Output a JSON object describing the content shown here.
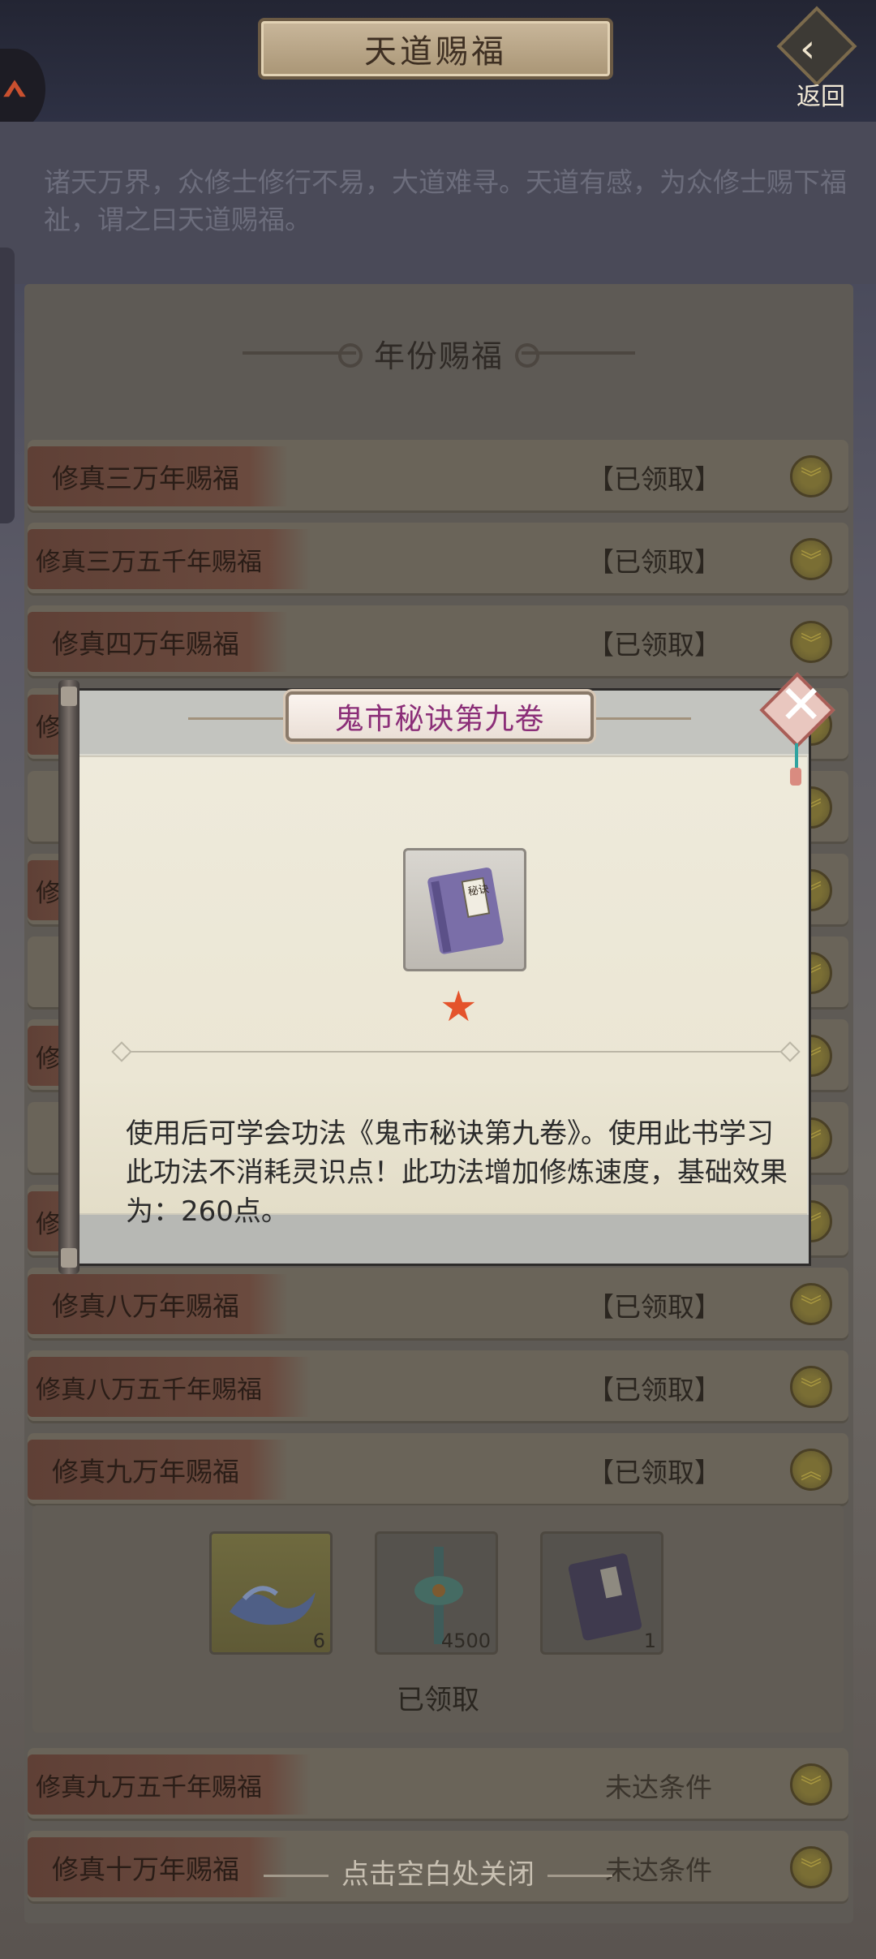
{
  "header": {
    "title": "天道赐福",
    "back_label": "返回"
  },
  "intro": {
    "text": "诸天万界，众修士修行不易，大道难寻。天道有感，为众修士赐下福祉，谓之曰天道赐福。"
  },
  "section": {
    "title": "年份赐福"
  },
  "rows": [
    {
      "name": "修真三万年赐福",
      "status": "【已领取】"
    },
    {
      "name": "修真三万五千年赐福",
      "status": "【已领取】"
    },
    {
      "name": "修真四万年赐福",
      "status": "【已领取】"
    },
    {
      "name": "修",
      "status": ""
    },
    {
      "name": "",
      "status": ""
    },
    {
      "name": "修",
      "status": ""
    },
    {
      "name": "",
      "status": ""
    },
    {
      "name": "修",
      "status": ""
    },
    {
      "name": "",
      "status": ""
    },
    {
      "name": "修",
      "status": ""
    },
    {
      "name": "修真八万年赐福",
      "status": "【已领取】"
    },
    {
      "name": "修真八万五千年赐福",
      "status": "【已领取】"
    },
    {
      "name": "修真九万年赐福",
      "status": "【已领取】"
    },
    {
      "name": "修真九万五千年赐福",
      "status": "未达条件"
    },
    {
      "name": "修真十万年赐福",
      "status": "未达条件"
    }
  ],
  "expanded": {
    "rewards": [
      {
        "icon": "water-wave-icon",
        "count": "6"
      },
      {
        "icon": "jade-pendant-icon",
        "count": "4500"
      },
      {
        "icon": "manual-book-icon",
        "count": "1"
      }
    ],
    "status": "已领取"
  },
  "modal": {
    "title": "鬼市秘诀第九卷",
    "item_icon": "purple-book-icon",
    "item_label": "秘诀",
    "stars": 1,
    "description": "使用后可学会功法《鬼市秘诀第九卷》。使用此书学习此功法不消耗灵识点！此功法增加修炼速度，基础效果为：260点。"
  },
  "close_hint": "点击空白处关闭",
  "colors": {
    "title_text": "#8b2e78",
    "star": "#e4532b",
    "close_accent": "#a95e57"
  }
}
